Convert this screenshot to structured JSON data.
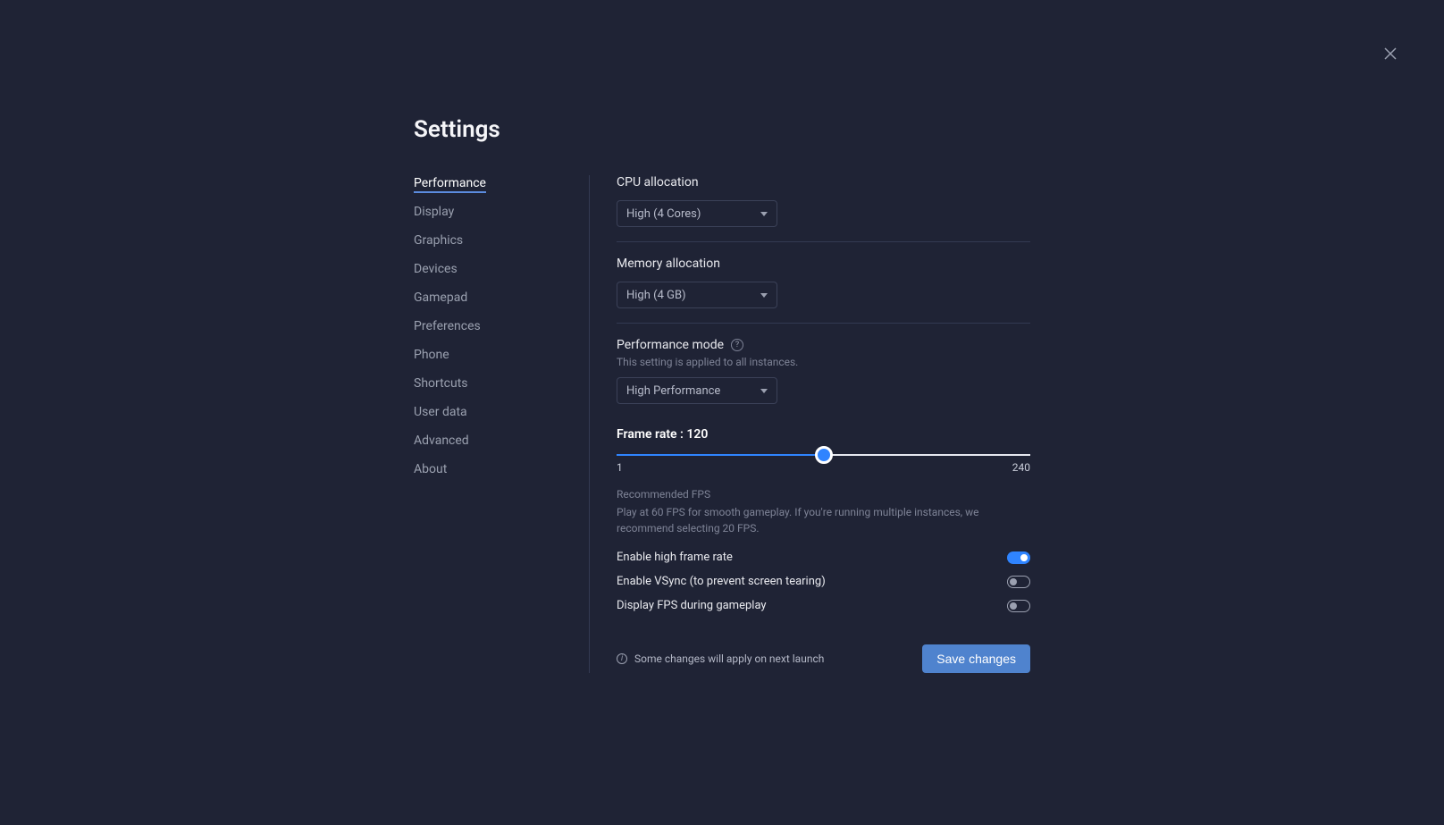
{
  "title": "Settings",
  "sidebar": {
    "items": [
      {
        "label": "Performance",
        "active": true
      },
      {
        "label": "Display"
      },
      {
        "label": "Graphics"
      },
      {
        "label": "Devices"
      },
      {
        "label": "Gamepad"
      },
      {
        "label": "Preferences"
      },
      {
        "label": "Phone"
      },
      {
        "label": "Shortcuts"
      },
      {
        "label": "User data"
      },
      {
        "label": "Advanced"
      },
      {
        "label": "About"
      }
    ]
  },
  "performance": {
    "cpu": {
      "label": "CPU allocation",
      "value": "High (4 Cores)"
    },
    "memory": {
      "label": "Memory allocation",
      "value": "High (4 GB)"
    },
    "mode": {
      "label": "Performance mode",
      "subtitle": "This setting is applied to all instances.",
      "value": "High Performance"
    },
    "framerate": {
      "label": "Frame rate : 120",
      "min": "1",
      "max": "240",
      "value": 120,
      "fill_percent": 50
    },
    "recommended": {
      "title": "Recommended FPS",
      "body": "Play at 60 FPS for smooth gameplay. If you're running multiple instances, we recommend selecting 20 FPS."
    },
    "toggles": {
      "high_fps": {
        "label": "Enable high frame rate",
        "on": true
      },
      "vsync": {
        "label": "Enable VSync (to prevent screen tearing)",
        "on": false
      },
      "display_fps": {
        "label": "Display FPS during gameplay",
        "on": false
      }
    }
  },
  "footer": {
    "note": "Some changes will apply on next launch",
    "save": "Save changes"
  }
}
